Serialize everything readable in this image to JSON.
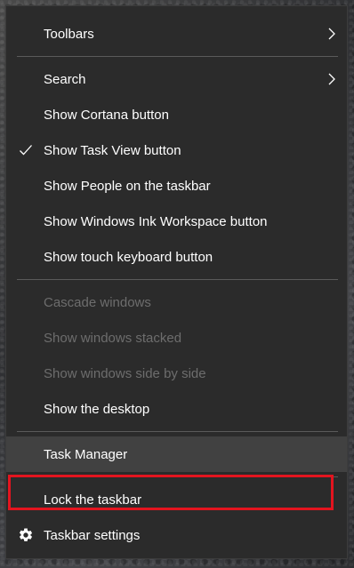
{
  "menu": {
    "toolbars": "Toolbars",
    "search": "Search",
    "show_cortana": "Show Cortana button",
    "show_task_view": "Show Task View button",
    "show_people": "Show People on the taskbar",
    "show_ink": "Show Windows Ink Workspace button",
    "show_touch_keyboard": "Show touch keyboard button",
    "cascade": "Cascade windows",
    "stacked": "Show windows stacked",
    "side_by_side": "Show windows side by side",
    "show_desktop": "Show the desktop",
    "task_manager": "Task Manager",
    "lock_taskbar": "Lock the taskbar",
    "taskbar_settings": "Taskbar settings"
  },
  "state": {
    "task_view_checked": true
  },
  "colors": {
    "menu_bg": "#2b2b2b",
    "highlight_bg": "#414141",
    "disabled_text": "#6d6d6d",
    "callout_red": "#e3141f"
  },
  "icons": {
    "submenu": "chevron-right-icon",
    "checked": "checkmark-icon",
    "settings": "gear-icon"
  }
}
